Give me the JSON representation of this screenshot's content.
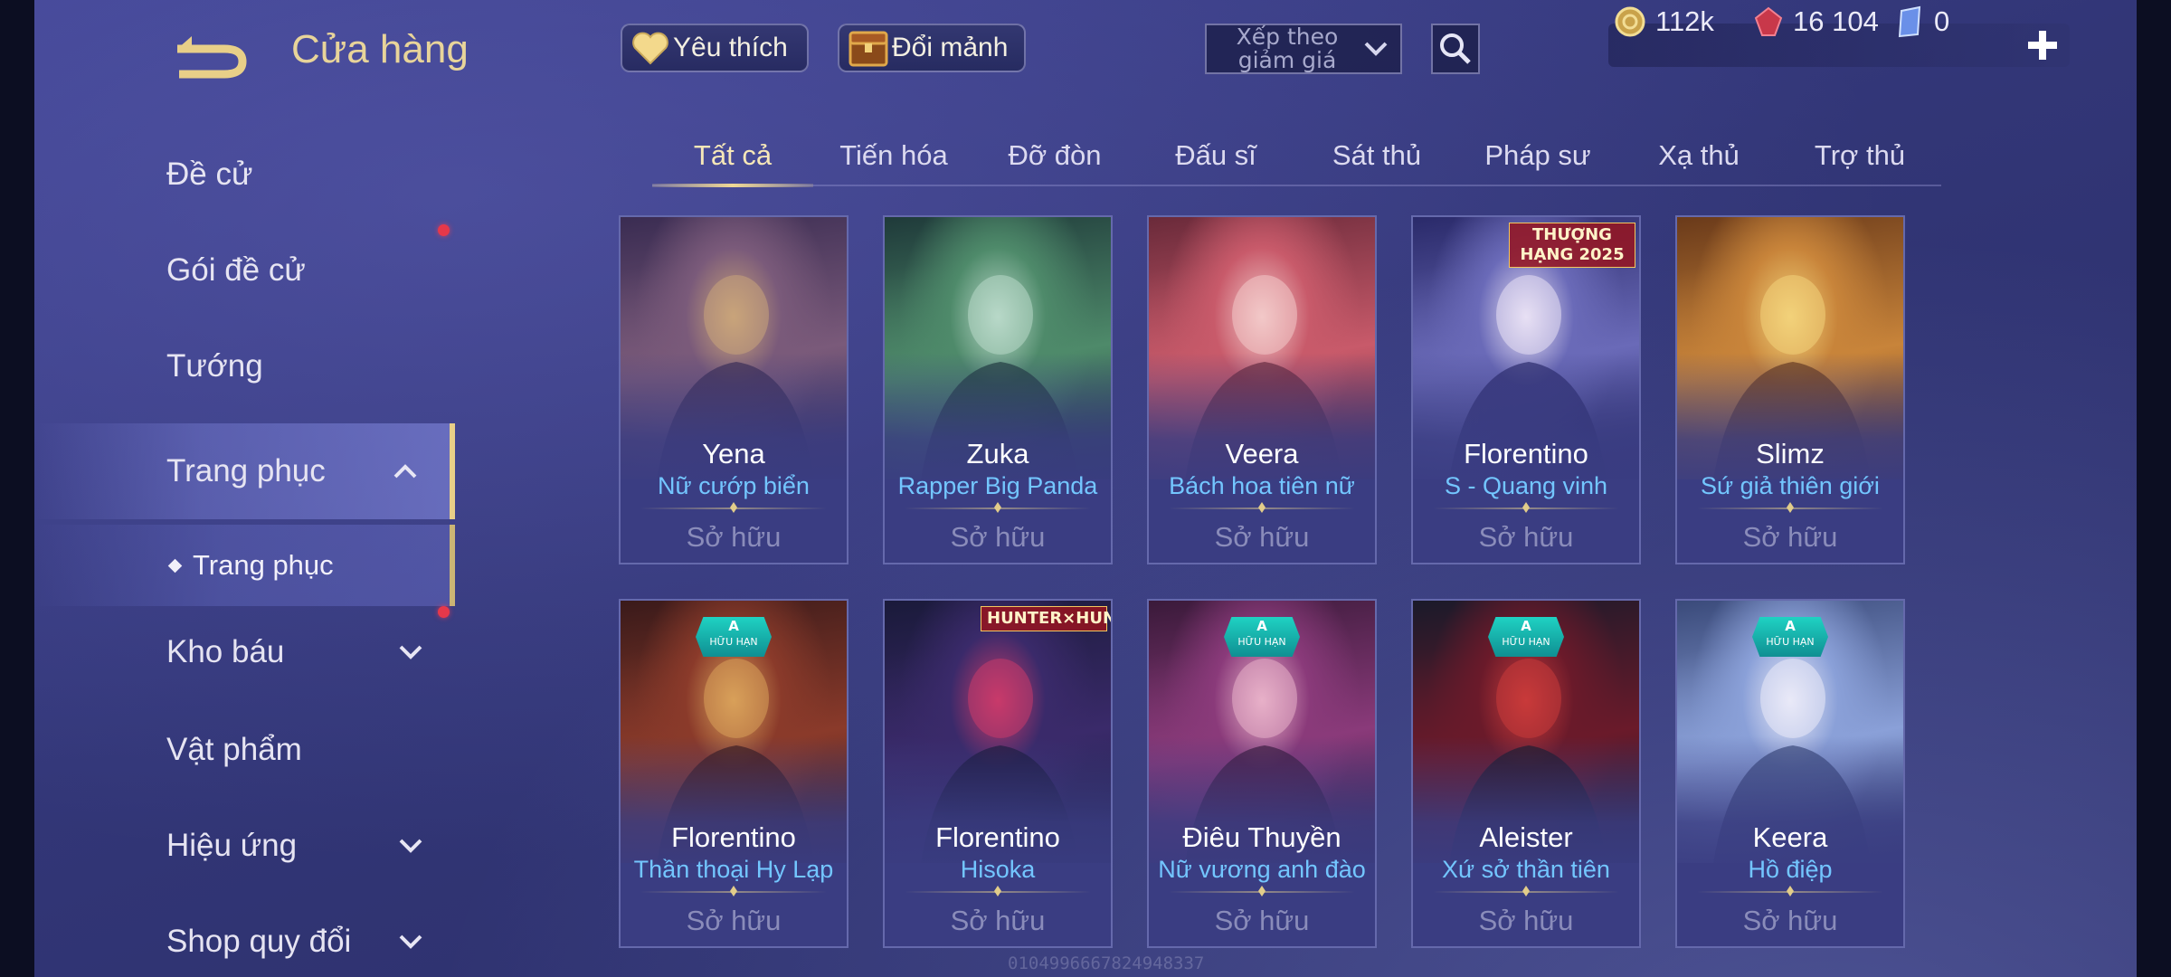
{
  "header": {
    "title": "Cửa hàng",
    "favorite_label": "Yêu thích",
    "exchange_label": "Đổi mảnh",
    "sort_label": "Xếp theo giảm giá",
    "currencies": [
      {
        "icon": "gold-coin-icon",
        "value": "112k"
      },
      {
        "icon": "red-gem-icon",
        "value": "16 104"
      },
      {
        "icon": "blue-voucher-icon",
        "value": "0"
      }
    ]
  },
  "sidebar": {
    "items": [
      {
        "label": "Đề cử"
      },
      {
        "label": "Gói đề cử",
        "dot": true
      },
      {
        "label": "Tướng"
      },
      {
        "label": "Trang phục",
        "expanded": true
      },
      {
        "label": "Trang phục",
        "sub": true
      },
      {
        "label": "Kho báu",
        "dot": true,
        "chevron": "down"
      },
      {
        "label": "Vật phẩm"
      },
      {
        "label": "Hiệu ứng",
        "chevron": "down"
      },
      {
        "label": "Shop quy đổi",
        "chevron": "down"
      }
    ]
  },
  "tabs": [
    "Tất cả",
    "Tiến hóa",
    "Đỡ đòn",
    "Đấu sĩ",
    "Sát thủ",
    "Pháp sư",
    "Xạ thủ",
    "Trợ thủ"
  ],
  "active_tab": "Tất cả",
  "cards": [
    {
      "hero": "Yena",
      "skin": "Nữ cướp biển",
      "status": "Sở hữu",
      "palette": [
        "#3a2c52",
        "#7a5a7a",
        "#c9a47a"
      ],
      "badge": ""
    },
    {
      "hero": "Zuka",
      "skin": "Rapper Big Panda",
      "status": "Sở hữu",
      "palette": [
        "#1f3a3a",
        "#4e8a6a",
        "#b8d8c8"
      ],
      "badge": ""
    },
    {
      "hero": "Veera",
      "skin": "Bách hoa tiên nữ",
      "status": "Sở hữu",
      "palette": [
        "#6a2a3a",
        "#c85a6a",
        "#f2c8c8"
      ],
      "badge": ""
    },
    {
      "hero": "Florentino",
      "skin": "S - Quang vinh",
      "status": "Sở hữu",
      "palette": [
        "#2a2a6a",
        "#6a6ab8",
        "#e8e0f4"
      ],
      "badge": "",
      "ribbon": "THƯỢNG HẠNG 2025"
    },
    {
      "hero": "Slimz",
      "skin": "Sứ giả thiên giới",
      "status": "Sở hữu",
      "palette": [
        "#6a3a1a",
        "#c8843a",
        "#f2d27a"
      ],
      "badge": ""
    },
    {
      "hero": "Florentino",
      "skin": "Thần thoại Hy Lạp",
      "status": "Sở hữu",
      "palette": [
        "#3a1a1a",
        "#8a3a2a",
        "#d8a05a"
      ],
      "badge": "A"
    },
    {
      "hero": "Florentino",
      "skin": "Hisoka",
      "status": "Sở hữu",
      "palette": [
        "#1a1a3a",
        "#3a2a6a",
        "#c83a6a"
      ],
      "badge": "",
      "ribbon": "HUNTER×HUNTER"
    },
    {
      "hero": "Điêu Thuyền",
      "skin": "Nữ vương anh đào",
      "status": "Sở hữu",
      "palette": [
        "#3a1a3a",
        "#8a3a7a",
        "#e8b0c8"
      ],
      "badge": "A"
    },
    {
      "hero": "Aleister",
      "skin": "Xứ sở thần tiên",
      "status": "Sở hữu",
      "palette": [
        "#1a1a2a",
        "#6a1a2a",
        "#c83a3a"
      ],
      "badge": "A"
    },
    {
      "hero": "Keera",
      "skin": "Hồ điệp",
      "status": "Sở hữu",
      "palette": [
        "#3a4a7a",
        "#8aa0d8",
        "#eaeaf8"
      ],
      "badge": "A"
    }
  ],
  "badge_text": {
    "grade": "A",
    "limited": "HỮU HẠN"
  },
  "watermark": "0104996667824948337"
}
